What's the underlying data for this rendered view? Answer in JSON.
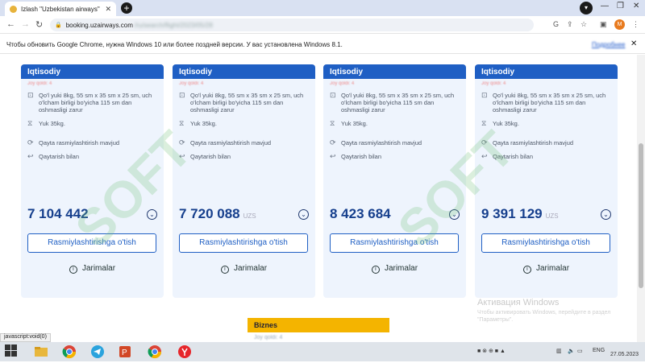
{
  "browser": {
    "tab_title": "Izlash \"Uzbekistan airways\"",
    "url_domain": "booking.uzairways.com",
    "url_rest": "/ru/search/flight/2023/05/28",
    "infobar_message": "Чтобы обновить Google Chrome, нужна Windows 10 или более поздней версии. У вас установлена Windows 8.1.",
    "infobar_link": "Подробнее"
  },
  "cards": [
    {
      "tariff": "Iqtisodiy",
      "seats_note": "Joy qoldi: 4",
      "features": [
        {
          "icon": "bag-icon",
          "text": "Qo'l yuki 8kg, 55 sm x 35 sm x 25 sm, uch o'lcham birligi bo'yicha 115 sm dan oshmasligi zarur"
        },
        {
          "icon": "luggage-icon",
          "text": "Yuk 35kg."
        },
        {
          "icon": "refresh-icon",
          "text": "Qayta rasmiylashtirish mavjud"
        },
        {
          "icon": "return-icon",
          "text": "Qaytarish bilan"
        }
      ],
      "price": "7 104 442",
      "currency": "",
      "book_label": "Rasmiylashtirishga o'tish",
      "fines_label": "Jarimalar"
    },
    {
      "tariff": "Iqtisodiy",
      "seats_note": "Joy qoldi: 4",
      "features": [
        {
          "icon": "bag-icon",
          "text": "Qo'l yuki 8kg, 55 sm x 35 sm x 25 sm, uch o'lcham birligi bo'yicha 115 sm dan oshmasligi zarur"
        },
        {
          "icon": "luggage-icon",
          "text": "Yuk 35kg."
        },
        {
          "icon": "refresh-icon",
          "text": "Qayta rasmiylashtirish mavjud"
        },
        {
          "icon": "return-icon",
          "text": "Qaytarish bilan"
        }
      ],
      "price": "7 720 088",
      "currency": "UZS",
      "book_label": "Rasmiylashtirishga o'tish",
      "fines_label": "Jarimalar"
    },
    {
      "tariff": "Iqtisodiy",
      "seats_note": "Joy qoldi: 4",
      "features": [
        {
          "icon": "bag-icon",
          "text": "Qo'l yuki 8kg, 55 sm x 35 sm x 25 sm, uch o'lcham birligi bo'yicha 115 sm dan oshmasligi zarur"
        },
        {
          "icon": "luggage-icon",
          "text": "Yuk 35kg."
        },
        {
          "icon": "refresh-icon",
          "text": "Qayta rasmiylashtirish mavjud"
        },
        {
          "icon": "return-icon",
          "text": "Qaytarish bilan"
        }
      ],
      "price": "8 423 684",
      "currency": "",
      "book_label": "Rasmiylashtirishga o'tish",
      "fines_label": "Jarimalar"
    },
    {
      "tariff": "Iqtisodiy",
      "seats_note": "Joy qoldi: 4",
      "features": [
        {
          "icon": "bag-icon",
          "text": "Qo'l yuki 8kg, 55 sm x 35 sm x 25 sm, uch o'lcham birligi bo'yicha 115 sm dan oshmasligi zarur"
        },
        {
          "icon": "luggage-icon",
          "text": "Yuk 35kg."
        },
        {
          "icon": "refresh-icon",
          "text": "Qayta rasmiylashtirish mavjud"
        },
        {
          "icon": "return-icon",
          "text": "Qaytarish bilan"
        }
      ],
      "price": "9 391 129",
      "currency": "UZS",
      "book_label": "Rasmiylashtirishga o'tish",
      "fines_label": "Jarimalar"
    }
  ],
  "business": {
    "label": "Biznes",
    "sub": "Joy qoldi: 4"
  },
  "windows_activation": {
    "title": "Активация Windows",
    "sub": "Чтобы активировать Windows, перейдите в раздел \"Параметры\"."
  },
  "status_url": "javascript:void(0)",
  "watermark": "SOFT",
  "taskbar": {
    "lang": "ENG",
    "time": "27.05.2023"
  },
  "colors": {
    "header_blue": "#1f5fc4",
    "price_blue": "#163f8d",
    "card_bg": "#eef4fd",
    "biz_yellow": "#f4b400"
  }
}
